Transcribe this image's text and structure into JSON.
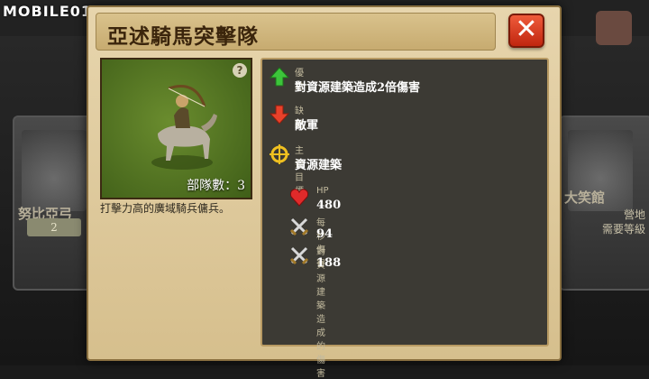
{
  "brand": "MOBILE01",
  "dialog": {
    "title": "亞述騎馬突擊隊",
    "close_label": "✕",
    "unit": {
      "help": "?",
      "squad_count": "部隊數：3",
      "description": "打擊力高的廣域騎兵傭兵。"
    },
    "info": {
      "strength_label": "優點",
      "strength_value": "對資源建築造成2倍傷害",
      "weakness_label": "缺點",
      "weakness_value": "敵軍",
      "target_label": "主要目標",
      "target_value": "資源建築",
      "stats": [
        {
          "label": "HP",
          "value": "480",
          "icon": "heart-icon"
        },
        {
          "label": "每秒傷害",
          "value": "94",
          "icon": "crossed-swords-icon"
        },
        {
          "label": "對資源建築造成的傷害",
          "value": "188",
          "icon": "crossed-swords-icon"
        }
      ]
    }
  },
  "background": {
    "left_card_name": "努比亞弓",
    "left_card_tag": "2",
    "right_card_name": "大笑館",
    "right_card_sub1": "營地",
    "right_card_sub2": "需要等級"
  },
  "colors": {
    "accent": "#3b250c",
    "close": "#d9361b",
    "panel": "#3c3a34"
  }
}
